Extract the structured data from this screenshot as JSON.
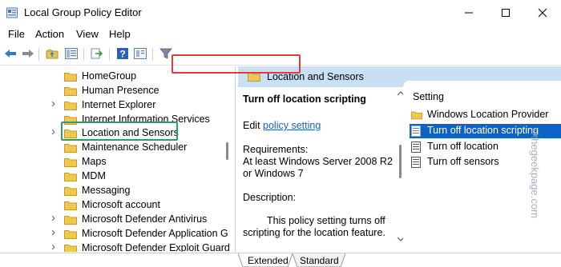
{
  "window": {
    "title": "Local Group Policy Editor",
    "controls": [
      "minimize",
      "maximize",
      "close"
    ]
  },
  "menu": {
    "items": [
      "File",
      "Action",
      "View",
      "Help"
    ]
  },
  "toolbar": {
    "icons": [
      "back-icon",
      "forward-icon",
      "up-folder-icon",
      "show-hide-tree-icon",
      "export-list-icon",
      "help-icon",
      "properties-icon",
      "filter-icon"
    ]
  },
  "tree": {
    "items": [
      {
        "label": "HomeGroup",
        "expandable": false
      },
      {
        "label": "Human Presence",
        "expandable": false
      },
      {
        "label": "Internet Explorer",
        "expandable": true
      },
      {
        "label": "Internet Information Services",
        "expandable": false
      },
      {
        "label": "Location and Sensors",
        "expandable": true,
        "highlighted": true
      },
      {
        "label": "Maintenance Scheduler",
        "expandable": false
      },
      {
        "label": "Maps",
        "expandable": false
      },
      {
        "label": "MDM",
        "expandable": false
      },
      {
        "label": "Messaging",
        "expandable": false
      },
      {
        "label": "Microsoft account",
        "expandable": false
      },
      {
        "label": "Microsoft Defender Antivirus",
        "expandable": true
      },
      {
        "label": "Microsoft Defender Application G",
        "expandable": true
      },
      {
        "label": "Microsoft Defender Exploit Guard",
        "expandable": true
      }
    ]
  },
  "right_pane": {
    "header": "Location and Sensors",
    "description": {
      "title": "Turn off location scripting",
      "edit_prefix": "Edit",
      "edit_link": "policy setting",
      "requirements_label": "Requirements:",
      "requirements_line1": "At least Windows Server 2008 R2",
      "requirements_line2": "or Windows 7",
      "description_label": "Description:",
      "description_line1": "This policy setting turns off",
      "description_line2": "scripting for the location feature."
    },
    "settings": {
      "column_header": "Setting",
      "rows": [
        {
          "label": "Windows Location Provider",
          "type": "folder"
        },
        {
          "label": "Turn off location scripting",
          "type": "policy",
          "selected": true
        },
        {
          "label": "Turn off location",
          "type": "policy"
        },
        {
          "label": "Turn off sensors",
          "type": "policy"
        }
      ]
    }
  },
  "watermark": "©thegeekpage.com",
  "tabs": [
    "Extended",
    "Standard"
  ],
  "colors": {
    "header_bg": "#c9dff3",
    "selection": "#0e63c9",
    "green_highlight": "#2e9b68",
    "red_highlight": "#e23b3b",
    "link": "#1a5fb4"
  }
}
